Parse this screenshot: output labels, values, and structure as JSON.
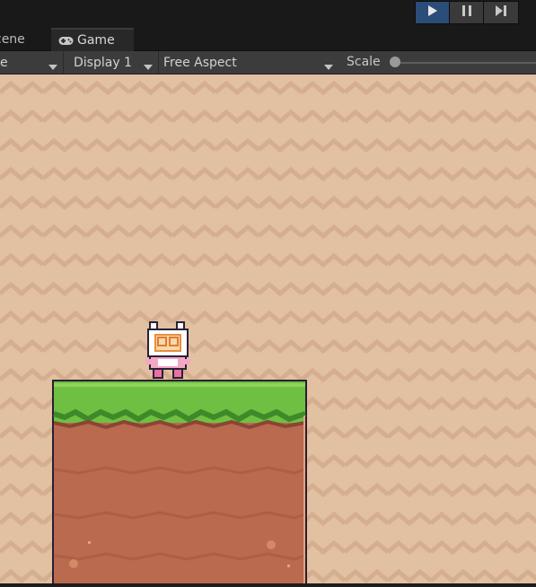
{
  "toolbar": {
    "play_controls": [
      {
        "icon": "play-icon",
        "active": true
      },
      {
        "icon": "pause-icon",
        "active": false
      },
      {
        "icon": "step-icon",
        "active": false
      }
    ]
  },
  "tabs": [
    {
      "label": "cene",
      "icon": null,
      "active": false
    },
    {
      "label": "Game",
      "icon": "gamepad-icon",
      "active": true
    }
  ],
  "game_toolbar": {
    "mode_value": "e",
    "display_value": "Display 1",
    "aspect_value": "Free Aspect",
    "scale_label": "Scale",
    "scale_value": 0
  },
  "colors": {
    "play_active": "#2b4d79",
    "background": "#e2c0a2",
    "background_pattern": "#d5ae90",
    "grass": "#6fc042",
    "dirt": "#b96a4f"
  }
}
